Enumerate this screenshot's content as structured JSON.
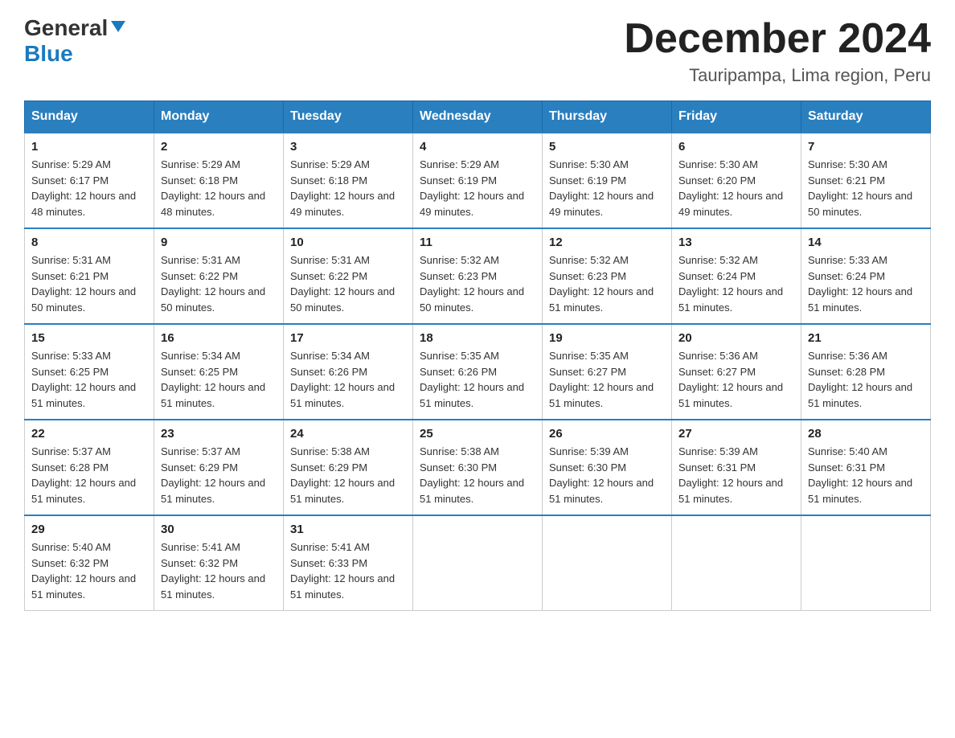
{
  "logo": {
    "general": "General",
    "blue": "Blue",
    "triangle_color": "#1a7abf"
  },
  "header": {
    "month_year": "December 2024",
    "location": "Tauripampa, Lima region, Peru"
  },
  "columns": [
    "Sunday",
    "Monday",
    "Tuesday",
    "Wednesday",
    "Thursday",
    "Friday",
    "Saturday"
  ],
  "weeks": [
    [
      {
        "day": "1",
        "sunrise": "Sunrise: 5:29 AM",
        "sunset": "Sunset: 6:17 PM",
        "daylight": "Daylight: 12 hours and 48 minutes."
      },
      {
        "day": "2",
        "sunrise": "Sunrise: 5:29 AM",
        "sunset": "Sunset: 6:18 PM",
        "daylight": "Daylight: 12 hours and 48 minutes."
      },
      {
        "day": "3",
        "sunrise": "Sunrise: 5:29 AM",
        "sunset": "Sunset: 6:18 PM",
        "daylight": "Daylight: 12 hours and 49 minutes."
      },
      {
        "day": "4",
        "sunrise": "Sunrise: 5:29 AM",
        "sunset": "Sunset: 6:19 PM",
        "daylight": "Daylight: 12 hours and 49 minutes."
      },
      {
        "day": "5",
        "sunrise": "Sunrise: 5:30 AM",
        "sunset": "Sunset: 6:19 PM",
        "daylight": "Daylight: 12 hours and 49 minutes."
      },
      {
        "day": "6",
        "sunrise": "Sunrise: 5:30 AM",
        "sunset": "Sunset: 6:20 PM",
        "daylight": "Daylight: 12 hours and 49 minutes."
      },
      {
        "day": "7",
        "sunrise": "Sunrise: 5:30 AM",
        "sunset": "Sunset: 6:21 PM",
        "daylight": "Daylight: 12 hours and 50 minutes."
      }
    ],
    [
      {
        "day": "8",
        "sunrise": "Sunrise: 5:31 AM",
        "sunset": "Sunset: 6:21 PM",
        "daylight": "Daylight: 12 hours and 50 minutes."
      },
      {
        "day": "9",
        "sunrise": "Sunrise: 5:31 AM",
        "sunset": "Sunset: 6:22 PM",
        "daylight": "Daylight: 12 hours and 50 minutes."
      },
      {
        "day": "10",
        "sunrise": "Sunrise: 5:31 AM",
        "sunset": "Sunset: 6:22 PM",
        "daylight": "Daylight: 12 hours and 50 minutes."
      },
      {
        "day": "11",
        "sunrise": "Sunrise: 5:32 AM",
        "sunset": "Sunset: 6:23 PM",
        "daylight": "Daylight: 12 hours and 50 minutes."
      },
      {
        "day": "12",
        "sunrise": "Sunrise: 5:32 AM",
        "sunset": "Sunset: 6:23 PM",
        "daylight": "Daylight: 12 hours and 51 minutes."
      },
      {
        "day": "13",
        "sunrise": "Sunrise: 5:32 AM",
        "sunset": "Sunset: 6:24 PM",
        "daylight": "Daylight: 12 hours and 51 minutes."
      },
      {
        "day": "14",
        "sunrise": "Sunrise: 5:33 AM",
        "sunset": "Sunset: 6:24 PM",
        "daylight": "Daylight: 12 hours and 51 minutes."
      }
    ],
    [
      {
        "day": "15",
        "sunrise": "Sunrise: 5:33 AM",
        "sunset": "Sunset: 6:25 PM",
        "daylight": "Daylight: 12 hours and 51 minutes."
      },
      {
        "day": "16",
        "sunrise": "Sunrise: 5:34 AM",
        "sunset": "Sunset: 6:25 PM",
        "daylight": "Daylight: 12 hours and 51 minutes."
      },
      {
        "day": "17",
        "sunrise": "Sunrise: 5:34 AM",
        "sunset": "Sunset: 6:26 PM",
        "daylight": "Daylight: 12 hours and 51 minutes."
      },
      {
        "day": "18",
        "sunrise": "Sunrise: 5:35 AM",
        "sunset": "Sunset: 6:26 PM",
        "daylight": "Daylight: 12 hours and 51 minutes."
      },
      {
        "day": "19",
        "sunrise": "Sunrise: 5:35 AM",
        "sunset": "Sunset: 6:27 PM",
        "daylight": "Daylight: 12 hours and 51 minutes."
      },
      {
        "day": "20",
        "sunrise": "Sunrise: 5:36 AM",
        "sunset": "Sunset: 6:27 PM",
        "daylight": "Daylight: 12 hours and 51 minutes."
      },
      {
        "day": "21",
        "sunrise": "Sunrise: 5:36 AM",
        "sunset": "Sunset: 6:28 PM",
        "daylight": "Daylight: 12 hours and 51 minutes."
      }
    ],
    [
      {
        "day": "22",
        "sunrise": "Sunrise: 5:37 AM",
        "sunset": "Sunset: 6:28 PM",
        "daylight": "Daylight: 12 hours and 51 minutes."
      },
      {
        "day": "23",
        "sunrise": "Sunrise: 5:37 AM",
        "sunset": "Sunset: 6:29 PM",
        "daylight": "Daylight: 12 hours and 51 minutes."
      },
      {
        "day": "24",
        "sunrise": "Sunrise: 5:38 AM",
        "sunset": "Sunset: 6:29 PM",
        "daylight": "Daylight: 12 hours and 51 minutes."
      },
      {
        "day": "25",
        "sunrise": "Sunrise: 5:38 AM",
        "sunset": "Sunset: 6:30 PM",
        "daylight": "Daylight: 12 hours and 51 minutes."
      },
      {
        "day": "26",
        "sunrise": "Sunrise: 5:39 AM",
        "sunset": "Sunset: 6:30 PM",
        "daylight": "Daylight: 12 hours and 51 minutes."
      },
      {
        "day": "27",
        "sunrise": "Sunrise: 5:39 AM",
        "sunset": "Sunset: 6:31 PM",
        "daylight": "Daylight: 12 hours and 51 minutes."
      },
      {
        "day": "28",
        "sunrise": "Sunrise: 5:40 AM",
        "sunset": "Sunset: 6:31 PM",
        "daylight": "Daylight: 12 hours and 51 minutes."
      }
    ],
    [
      {
        "day": "29",
        "sunrise": "Sunrise: 5:40 AM",
        "sunset": "Sunset: 6:32 PM",
        "daylight": "Daylight: 12 hours and 51 minutes."
      },
      {
        "day": "30",
        "sunrise": "Sunrise: 5:41 AM",
        "sunset": "Sunset: 6:32 PM",
        "daylight": "Daylight: 12 hours and 51 minutes."
      },
      {
        "day": "31",
        "sunrise": "Sunrise: 5:41 AM",
        "sunset": "Sunset: 6:33 PM",
        "daylight": "Daylight: 12 hours and 51 minutes."
      },
      null,
      null,
      null,
      null
    ]
  ]
}
